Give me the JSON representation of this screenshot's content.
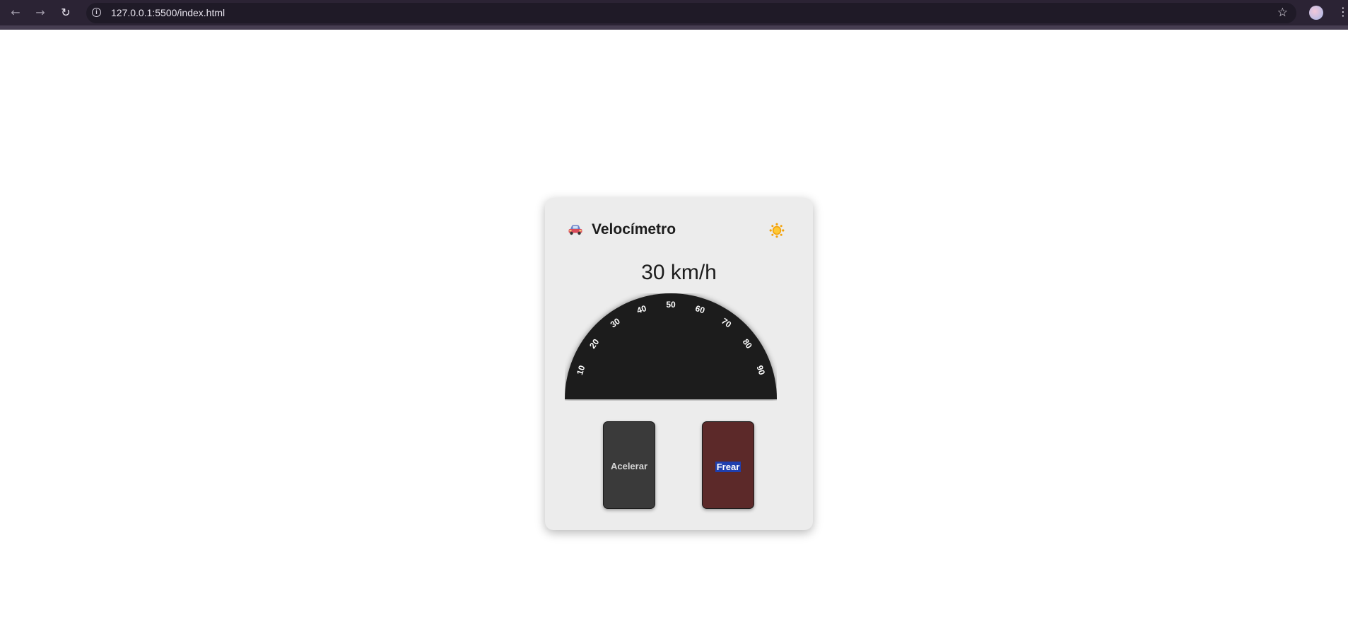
{
  "browser": {
    "url": "127.0.0.1:5500/index.html"
  },
  "app": {
    "title": "Velocímetro",
    "speed_display": "30 km/h",
    "speed_value": 30,
    "gauge_ticks": [
      "10",
      "20",
      "30",
      "40",
      "50",
      "60",
      "70",
      "80",
      "90"
    ],
    "accelerate_label": "Acelerar",
    "brake_label": "Frear",
    "icons": {
      "title": "car-icon",
      "theme": "sun-icon"
    },
    "colors": {
      "needle": "#ff0000",
      "gauge_face": "#1a1a1a",
      "accelerate_pedal": "#3a3a3a",
      "brake_pedal": "#5c2929",
      "card": "#ececec"
    }
  }
}
